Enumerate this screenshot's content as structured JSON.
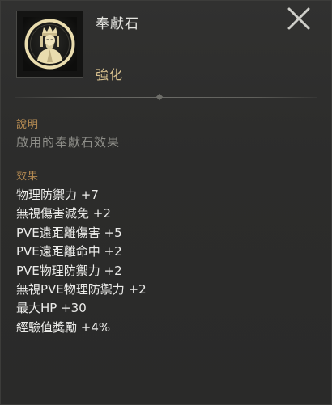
{
  "item": {
    "name": "奉獻石",
    "grade": "強化",
    "icon": "crowned-figure-medallion-icon"
  },
  "close": {
    "icon": "close-icon"
  },
  "description": {
    "title": "說明",
    "text": "啟用的奉獻石效果"
  },
  "effects": {
    "title": "效果",
    "items": [
      "物理防禦力 +7",
      "無視傷害減免 +2",
      "PVE遠距離傷害 +5",
      "PVE遠距離命中 +2",
      "PVE物理防禦力 +2",
      "無視PVE物理防禦力 +2",
      "最大HP +30",
      "經驗值獎勵 +4%"
    ]
  },
  "colors": {
    "background": "#2c2c2b",
    "section_title": "#b48a52",
    "grade": "#d7c08e",
    "description": "#8e8e89",
    "effect_text": "#ececea"
  }
}
